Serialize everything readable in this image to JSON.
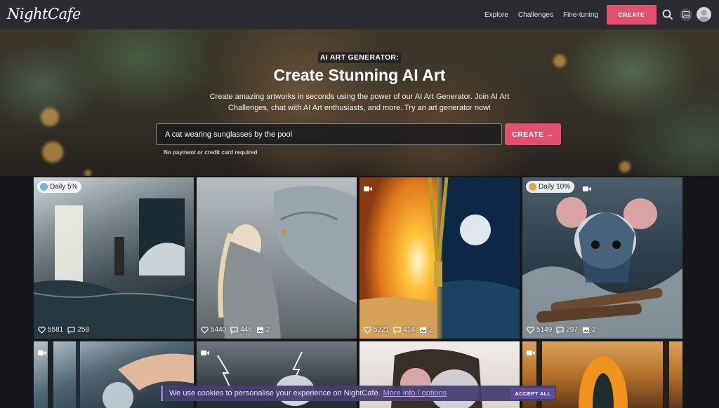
{
  "brand": {
    "logo_text": "NightCafe",
    "accent": "#e0506f"
  },
  "nav": {
    "links": [
      "Explore",
      "Challenges",
      "Fine-tuning"
    ],
    "create_label": "CREATE",
    "icons": [
      "search-icon",
      "gallery-icon",
      "avatar"
    ]
  },
  "hero": {
    "badge": "AI ART GENERATOR:",
    "title": "Create Stunning AI Art",
    "description": "Create amazing artworks in seconds using the power of our AI Art Generator. Join AI Art Challenges, chat with AI Art enthusiasts, and more. Try an art generator now!",
    "input_value": "A cat wearing sunglasses by the pool",
    "button_label": "CREATE →",
    "note": "No payment or credit card required"
  },
  "cards": [
    {
      "tag": "Daily 5%",
      "video": false,
      "likes": "5581",
      "comments": "258",
      "images": ""
    },
    {
      "tag": "",
      "video": false,
      "likes": "5440",
      "comments": "446",
      "images": "2"
    },
    {
      "tag": "",
      "video": true,
      "likes": "5221",
      "comments": "414",
      "images": "2"
    },
    {
      "tag": "Daily 10%",
      "video": true,
      "likes": "5149",
      "comments": "297",
      "images": "2"
    }
  ],
  "row2_video": [
    true,
    true,
    false,
    true
  ],
  "cookie": {
    "text": "We use cookies to personalise your experience on NightCafe.",
    "link": "More info / options",
    "button": "ACCEPT ALL"
  }
}
